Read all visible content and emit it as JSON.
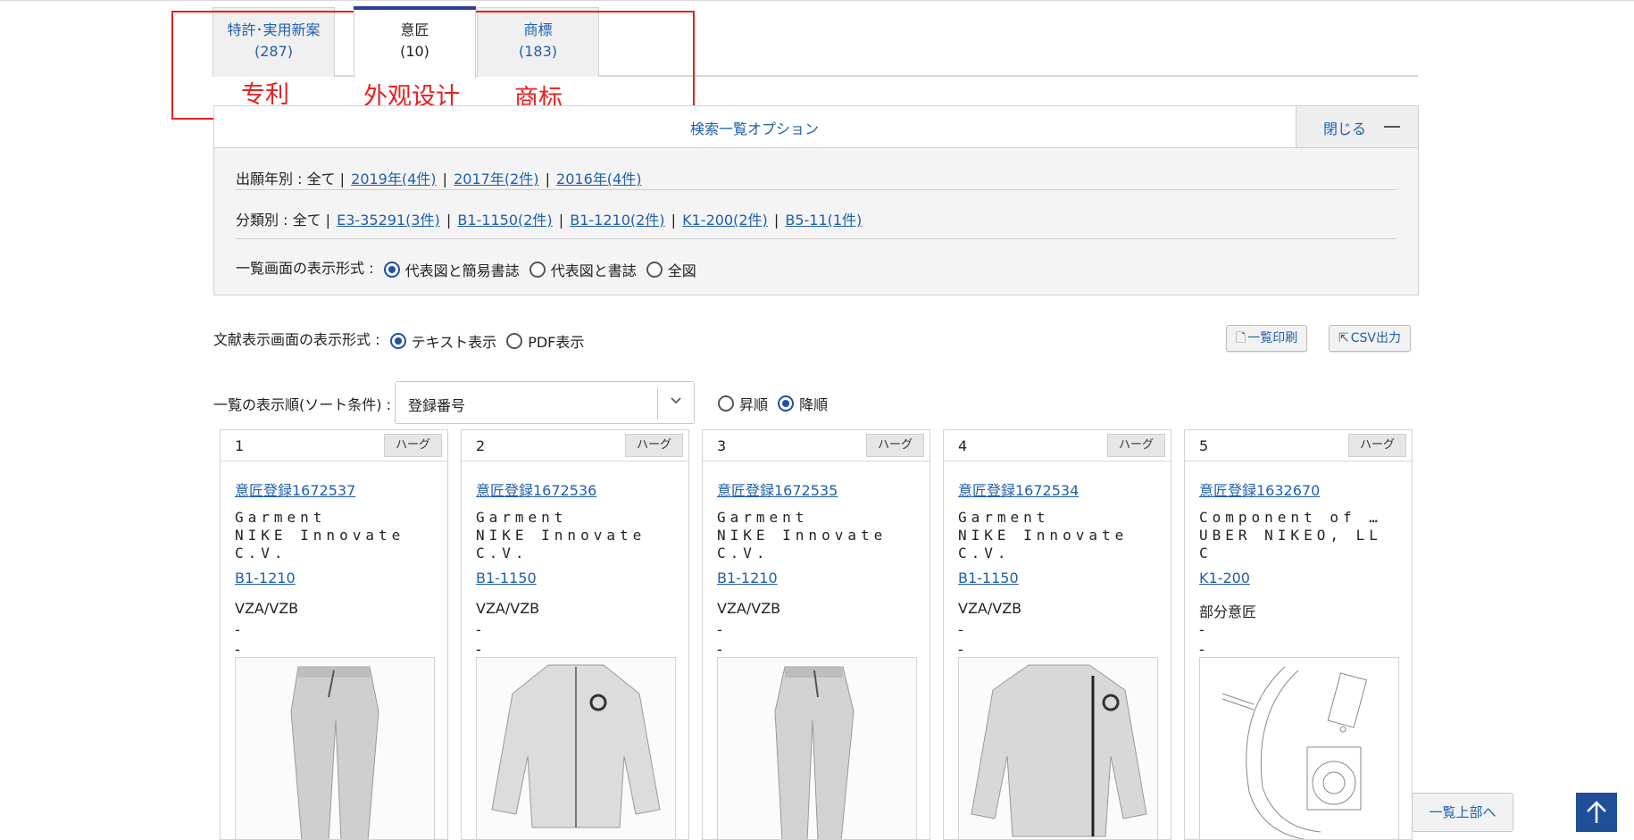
{
  "tabs": [
    {
      "label": "特許･実用新案",
      "count": "(287)"
    },
    {
      "label": "意匠",
      "count": "(10)"
    },
    {
      "label": "商標",
      "count": "(183)"
    }
  ],
  "annotations": {
    "patent": "专利",
    "design": "外观设计",
    "trademark": "商标"
  },
  "options_panel": {
    "title": "検索一覧オプション",
    "close_label": "閉じる",
    "year_filter": {
      "label": "出願年別 : 全て |",
      "links": [
        "2019年(4件)",
        "2017年(2件)",
        "2016年(4件)"
      ]
    },
    "class_filter": {
      "label": "分類別 : 全て |",
      "links": [
        "E3-35291(3件)",
        "B1-1150(2件)",
        "B1-1210(2件)",
        "K1-200(2件)",
        "B5-11(1件)"
      ]
    },
    "display_format": {
      "label": "一覧画面の表示形式 :",
      "options": [
        "代表図と簡易書誌",
        "代表図と書誌",
        "全図"
      ],
      "selected": "代表図と簡易書誌"
    }
  },
  "doc_display": {
    "label": "文献表示画面の表示形式 :",
    "options": [
      "テキスト表示",
      "PDF表示"
    ],
    "selected": "テキスト表示"
  },
  "buttons": {
    "print": "一覧印刷",
    "csv": "CSV出力"
  },
  "sort": {
    "label": "一覧の表示順(ソート条件) :",
    "value": "登録番号",
    "order_options": [
      "昇順",
      "降順"
    ],
    "order_selected": "降順"
  },
  "cards": [
    {
      "num": "1",
      "badge": "ハーグ",
      "reg": "意匠登録1672537",
      "name": "Garment\nNIKE Innovate\nC.V.",
      "cls": "B1-1210",
      "kind": "VZA/VZB",
      "d1": "-",
      "d2": "-",
      "image": "pants"
    },
    {
      "num": "2",
      "badge": "ハーグ",
      "reg": "意匠登録1672536",
      "name": "Garment\nNIKE Innovate\nC.V.",
      "cls": "B1-1150",
      "kind": "VZA/VZB",
      "d1": "-",
      "d2": "-",
      "image": "jacket"
    },
    {
      "num": "3",
      "badge": "ハーグ",
      "reg": "意匠登録1672535",
      "name": "Garment\nNIKE Innovate\nC.V.",
      "cls": "B1-1210",
      "kind": "VZA/VZB",
      "d1": "-",
      "d2": "-",
      "image": "pants"
    },
    {
      "num": "4",
      "badge": "ハーグ",
      "reg": "意匠登録1672534",
      "name": "Garment\nNIKE Innovate\nC.V.",
      "cls": "B1-1150",
      "kind": "VZA/VZB",
      "d1": "-",
      "d2": "-",
      "image": "jacket"
    },
    {
      "num": "5",
      "badge": "ハーグ",
      "reg": "意匠登録1632670",
      "name": "Component of …\nUBER NIKEO, LL\nC",
      "cls": "K1-200",
      "kind": "部分意匠",
      "d1": "-",
      "d2": "-",
      "image": "component"
    }
  ],
  "back_to_top": "一覧上部へ",
  "colors": {
    "link": "#1f5fae",
    "accent": "#2c3e95",
    "annotation": "#e82020"
  }
}
